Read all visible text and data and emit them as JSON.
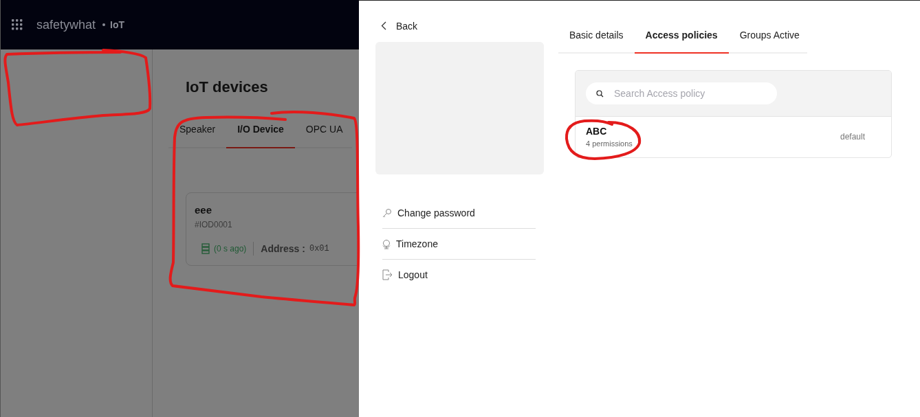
{
  "header": {
    "brand": "safetywhat",
    "section": "IoT"
  },
  "page": {
    "title": "IoT devices",
    "tabs": [
      {
        "label": "Speaker",
        "selected": false
      },
      {
        "label": "I/O Device",
        "selected": true
      },
      {
        "label": "OPC UA",
        "selected": false
      }
    ],
    "devices": [
      {
        "name": "eee",
        "id": "#IOD0001",
        "status": "(0 s ago)",
        "address_label": "Address :",
        "address": "0x01"
      }
    ]
  },
  "drawer": {
    "back": "Back",
    "menu": [
      {
        "label": "Change password"
      },
      {
        "label": "Timezone"
      },
      {
        "label": "Logout"
      }
    ],
    "tabs": [
      {
        "label": "Basic details",
        "selected": false
      },
      {
        "label": "Access policies",
        "selected": true
      },
      {
        "label": "Groups Active",
        "selected": false
      }
    ],
    "search": {
      "placeholder": "Search Access policy"
    },
    "policies": [
      {
        "name": "ABC",
        "permissions": "4 permissions",
        "tag": "default"
      }
    ]
  }
}
